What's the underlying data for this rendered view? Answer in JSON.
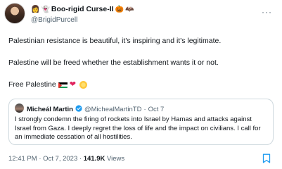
{
  "author": {
    "name": "Boo-rigid Curse-II",
    "handle": "@BrigidPurcell"
  },
  "more_label": "···",
  "tweet": {
    "line1": "Palestinian resistance is beautiful, it's inspiring and it's legitimate.",
    "line2": "Palestine will be freed whether the establishment wants it or not.",
    "line3": "Free Palestine"
  },
  "quote": {
    "name": "Micheál Martin",
    "handle": "@MichealMartinTD",
    "separator": "·",
    "date": "Oct 7",
    "text": "I strongly condemn the firing of rockets into Israel by Hamas and attacks against Israel from Gaza. I deeply regret the loss of life and the impact on civilians. I call for an immediate cessation of all hostilities."
  },
  "meta": {
    "time": "12:41 PM",
    "date": "Oct 7, 2023",
    "separator": "·",
    "views_count": "141.9K",
    "views_label": "Views"
  },
  "colors": {
    "text": "#0f1419",
    "secondary": "#536471",
    "border": "#cfd9de",
    "verified": "#1d9bf0",
    "heart": "#e0245e"
  },
  "icons": [
    "ellipsis-icon",
    "verified-badge-icon",
    "palestine-flag-emoji",
    "red-heart-emoji",
    "sun-emoji",
    "bookmark-icon"
  ]
}
